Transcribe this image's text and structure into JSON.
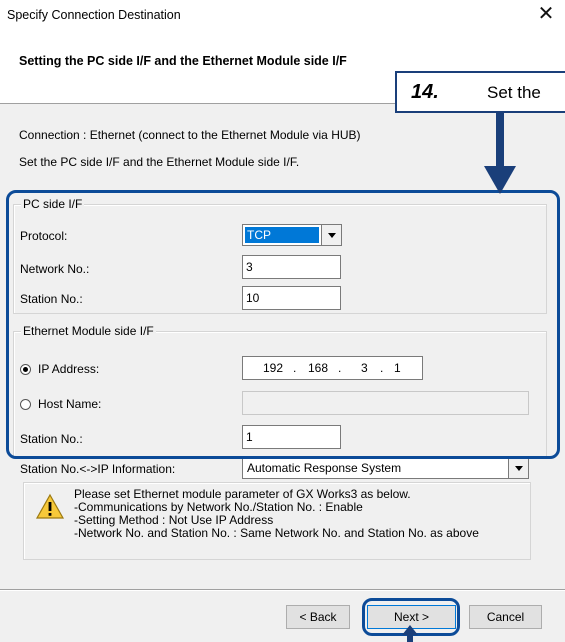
{
  "window": {
    "title": "Specify Connection Destination",
    "close_glyph": "✕"
  },
  "header": {
    "title": "Setting the PC side I/F and the Ethernet Module side I/F"
  },
  "info": {
    "connection": "Connection : Ethernet (connect to the Ethernet Module via HUB)",
    "instruction": "Set the PC side I/F and the Ethernet Module side I/F."
  },
  "pc_side": {
    "legend": "PC side I/F",
    "protocol_label": "Protocol:",
    "protocol_value": "TCP",
    "network_label": "Network No.:",
    "network_value": "3",
    "station_label": "Station No.:",
    "station_value": "10"
  },
  "module_side": {
    "legend": "Ethernet Module side I/F",
    "ip_label": "IP Address:",
    "ip_octets": [
      "192",
      "168",
      "3",
      "1"
    ],
    "host_label": "Host Name:",
    "host_value": "",
    "station_label": "Station No.:",
    "station_value": "1",
    "selected_option": "IP Address"
  },
  "ip_info": {
    "label": "Station No.<->IP Information:",
    "value": "Automatic Response System"
  },
  "warning": {
    "icon": "warning-icon",
    "lines": [
      "Please set Ethernet module parameter of GX Works3 as below.",
      "-Communications by Network No./Station No. : Enable",
      "-Setting Method : Not Use IP Address",
      "-Network No. and Station No. : Same Network No. and Station No. as above"
    ]
  },
  "buttons": {
    "back": "< Back",
    "next": "Next >",
    "cancel": "Cancel"
  },
  "callout": {
    "number": "14.",
    "text": "Set the"
  },
  "colors": {
    "highlight": "#0c4b98",
    "selection": "#0078d7"
  }
}
